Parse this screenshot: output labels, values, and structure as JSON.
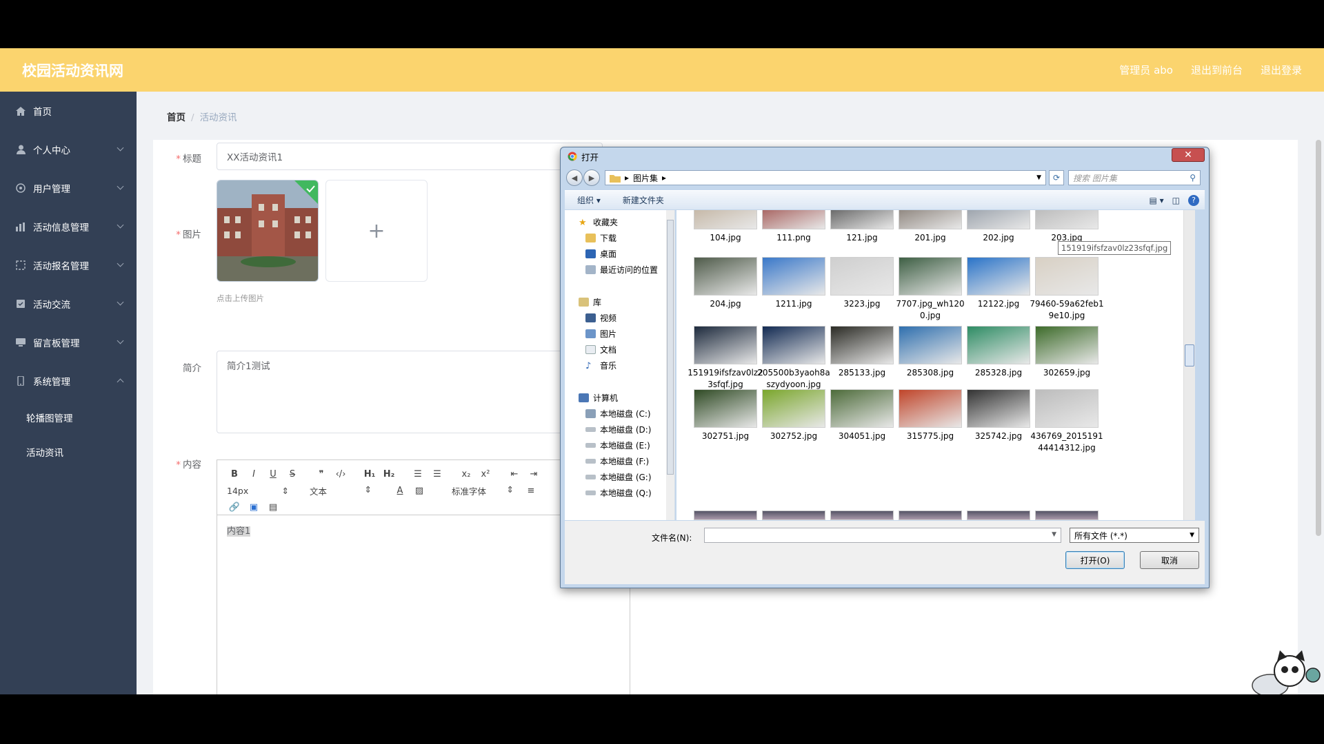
{
  "header": {
    "brand": "校园活动资讯网",
    "links": [
      "管理员 abo",
      "退出到前台",
      "退出登录"
    ]
  },
  "sidebar": {
    "items": [
      {
        "label": "首页",
        "icon": "home-icon"
      },
      {
        "label": "个人中心",
        "icon": "user-icon"
      },
      {
        "label": "用户管理",
        "icon": "users-icon"
      },
      {
        "label": "活动信息管理",
        "icon": "chart-icon"
      },
      {
        "label": "活动报名管理",
        "icon": "form-icon"
      },
      {
        "label": "活动交流",
        "icon": "chat-icon"
      },
      {
        "label": "留言板管理",
        "icon": "message-icon"
      },
      {
        "label": "系统管理",
        "icon": "system-icon"
      }
    ],
    "subitems": [
      "轮播图管理",
      "活动资讯"
    ]
  },
  "breadcrumb": {
    "home": "首页",
    "current": "活动资讯"
  },
  "form": {
    "title_label": "标题",
    "title_value": "XX活动资讯1",
    "image_label": "图片",
    "upload_hint": "点击上传图片",
    "intro_label": "简介",
    "intro_value": "简介1测试",
    "content_label": "内容",
    "content_value": "内容1",
    "editor": {
      "font_size": "14px",
      "text_type": "文本",
      "font_family": "标准字体"
    }
  },
  "dialog": {
    "title": "打开",
    "path": "图片集",
    "search_placeholder": "搜索 图片集",
    "organize": "组织 ▾",
    "new_folder": "新建文件夹",
    "nav": {
      "favorites": "收藏夹",
      "fav_items": [
        "下载",
        "桌面",
        "最近访问的位置"
      ],
      "libraries": "库",
      "lib_items": [
        "视频",
        "图片",
        "文档",
        "音乐"
      ],
      "computer": "计算机",
      "drives": [
        "本地磁盘 (C:)",
        "本地磁盘 (D:)",
        "本地磁盘 (E:)",
        "本地磁盘 (F:)",
        "本地磁盘 (G:)",
        "本地磁盘 (Q:)"
      ]
    },
    "files": [
      [
        "104.jpg",
        "111.png",
        "121.jpg",
        "201.jpg",
        "202.jpg",
        "203.jpg"
      ],
      [
        "204.jpg",
        "1211.jpg",
        "3223.jpg",
        "7707.jpg_wh1200.jpg",
        "12122.jpg",
        "79460-59a62feb19e10.jpg"
      ],
      [
        "151919ifsfzav0lz23sfqf.jpg",
        "205500b3yaoh8aszydyoon.jpg",
        "285133.jpg",
        "285308.jpg",
        "285328.jpg",
        "302659.jpg"
      ],
      [
        "302751.jpg",
        "302752.jpg",
        "304051.jpg",
        "315775.jpg",
        "325742.jpg",
        "436769_201519144414312.jpg"
      ]
    ],
    "tooltip": "151919ifsfzav0lz23sfqf.jpg",
    "filename_label": "文件名(N):",
    "filetype": "所有文件 (*.*)",
    "open_button": "打开(O)",
    "cancel_button": "取消"
  }
}
